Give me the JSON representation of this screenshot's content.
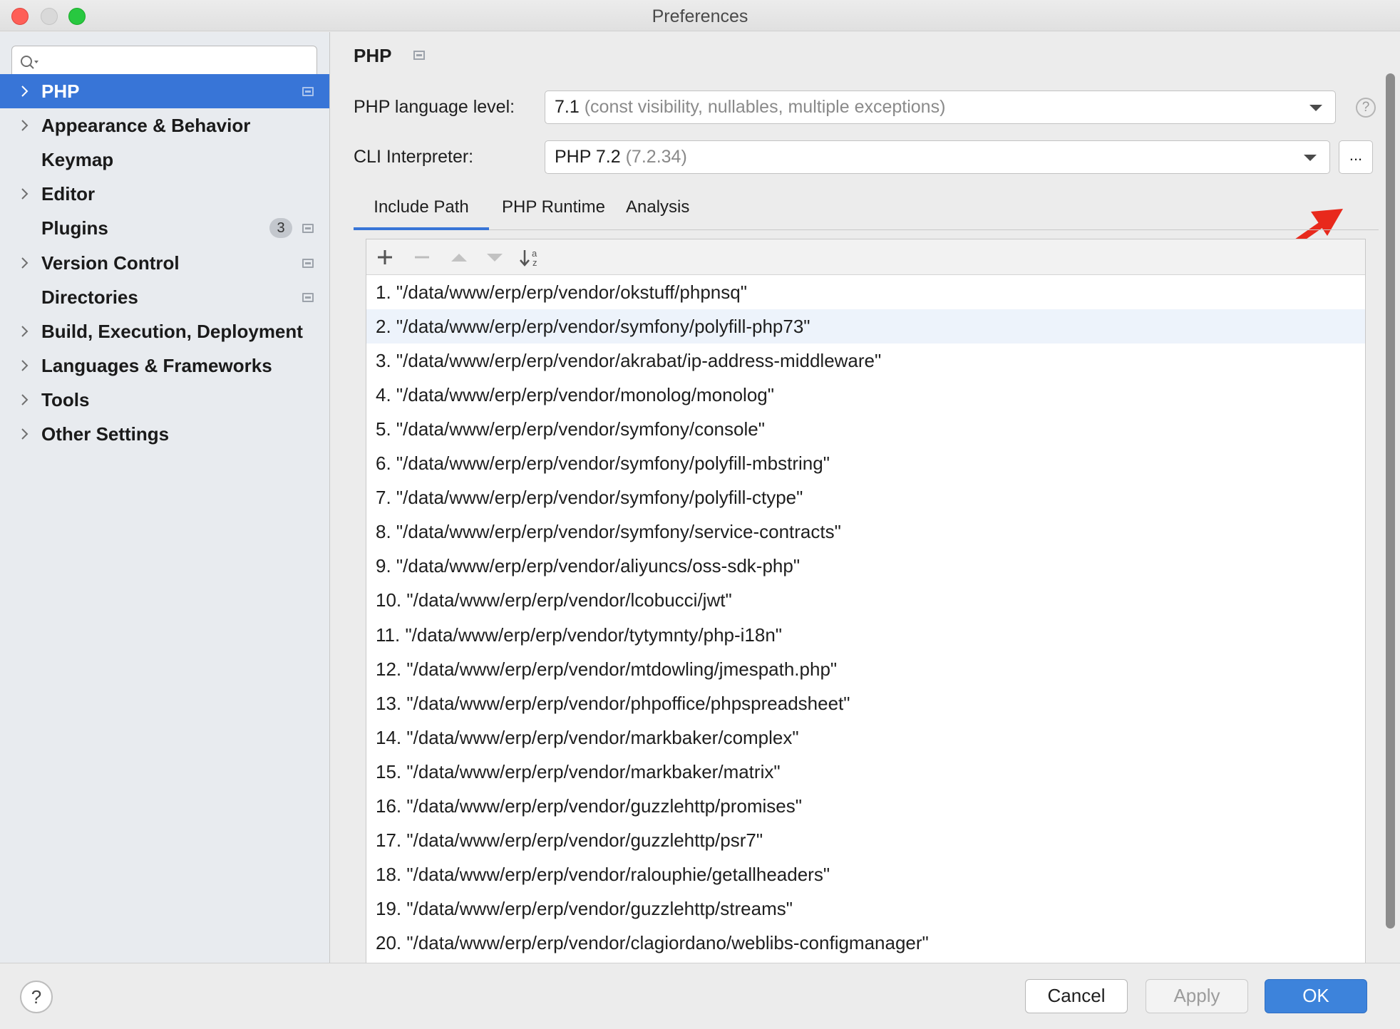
{
  "window": {
    "title": "Preferences"
  },
  "sidebar": {
    "search_placeholder": "",
    "items": [
      {
        "label": "PHP",
        "expandable": true,
        "selected": true,
        "project_scope_icon": true
      },
      {
        "label": "Appearance & Behavior",
        "expandable": true
      },
      {
        "label": "Keymap",
        "expandable": false
      },
      {
        "label": "Editor",
        "expandable": true
      },
      {
        "label": "Plugins",
        "expandable": false,
        "badge": "3",
        "project_scope_icon": true
      },
      {
        "label": "Version Control",
        "expandable": true,
        "project_scope_icon": true
      },
      {
        "label": "Directories",
        "expandable": false,
        "project_scope_icon": true
      },
      {
        "label": "Build, Execution, Deployment",
        "expandable": true
      },
      {
        "label": "Languages & Frameworks",
        "expandable": true
      },
      {
        "label": "Tools",
        "expandable": true
      },
      {
        "label": "Other Settings",
        "expandable": true
      }
    ]
  },
  "main": {
    "title": "PHP",
    "language_level": {
      "label": "PHP language level:",
      "value": "7.1",
      "detail": "(const visibility, nullables, multiple exceptions)"
    },
    "cli_interpreter": {
      "label": "CLI Interpreter:",
      "value": "PHP 7.2",
      "detail": "(7.2.34)",
      "more_label": "..."
    },
    "help_label": "?",
    "tabs": [
      {
        "label": "Include Path",
        "active": true
      },
      {
        "label": "PHP Runtime",
        "active": false
      },
      {
        "label": "Analysis",
        "active": false
      }
    ],
    "include_paths": [
      "1. \"/data/www/erp/erp/vendor/okstuff/phpnsq\"",
      "2. \"/data/www/erp/erp/vendor/symfony/polyfill-php73\"",
      "3. \"/data/www/erp/erp/vendor/akrabat/ip-address-middleware\"",
      "4. \"/data/www/erp/erp/vendor/monolog/monolog\"",
      "5. \"/data/www/erp/erp/vendor/symfony/console\"",
      "6. \"/data/www/erp/erp/vendor/symfony/polyfill-mbstring\"",
      "7. \"/data/www/erp/erp/vendor/symfony/polyfill-ctype\"",
      "8. \"/data/www/erp/erp/vendor/symfony/service-contracts\"",
      "9. \"/data/www/erp/erp/vendor/aliyuncs/oss-sdk-php\"",
      "10. \"/data/www/erp/erp/vendor/lcobucci/jwt\"",
      "11. \"/data/www/erp/erp/vendor/tytymnty/php-i18n\"",
      "12. \"/data/www/erp/erp/vendor/mtdowling/jmespath.php\"",
      "13. \"/data/www/erp/erp/vendor/phpoffice/phpspreadsheet\"",
      "14. \"/data/www/erp/erp/vendor/markbaker/complex\"",
      "15. \"/data/www/erp/erp/vendor/markbaker/matrix\"",
      "16. \"/data/www/erp/erp/vendor/guzzlehttp/promises\"",
      "17. \"/data/www/erp/erp/vendor/guzzlehttp/psr7\"",
      "18. \"/data/www/erp/erp/vendor/ralouphie/getallheaders\"",
      "19. \"/data/www/erp/erp/vendor/guzzlehttp/streams\"",
      "20. \"/data/www/erp/erp/vendor/clagiordano/weblibs-configmanager\""
    ],
    "toolbar_icons": [
      "add-icon",
      "remove-icon",
      "move-up-icon",
      "move-down-icon",
      "sort-alphabetically-icon"
    ]
  },
  "footer": {
    "help_label": "?",
    "cancel_label": "Cancel",
    "apply_label": "Apply",
    "ok_label": "OK"
  },
  "colors": {
    "accent": "#3875d7",
    "ok_button": "#3d83db",
    "annotation_arrow": "#e8291c"
  }
}
